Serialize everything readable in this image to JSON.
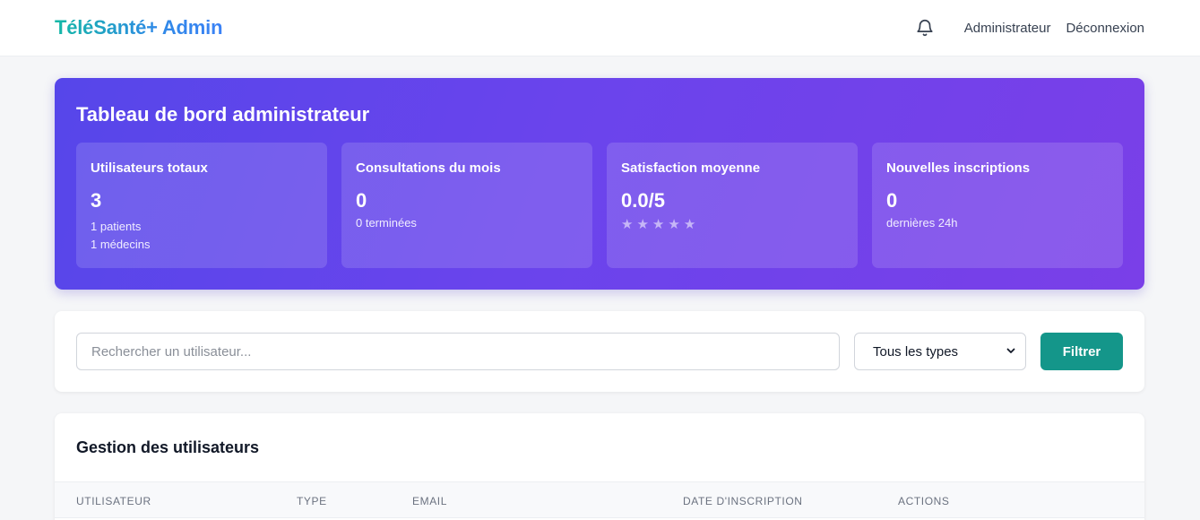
{
  "header": {
    "brand": "TéléSanté+ Admin",
    "user_link": "Administrateur",
    "logout_link": "Déconnexion",
    "bell_icon": "bell-icon"
  },
  "dashboard": {
    "title": "Tableau de bord administrateur",
    "stats": [
      {
        "label": "Utilisateurs totaux",
        "value": "3",
        "sub1": "1 patients",
        "sub2": "1 médecins"
      },
      {
        "label": "Consultations du mois",
        "value": "0",
        "sub1": "0 terminées"
      },
      {
        "label": "Satisfaction moyenne",
        "value": "0.0/5",
        "rating": 0,
        "rating_max": 5
      },
      {
        "label": "Nouvelles inscriptions",
        "value": "0",
        "sub1": "dernières 24h"
      }
    ]
  },
  "filters": {
    "search_placeholder": "Rechercher un utilisateur...",
    "search_value": "",
    "type_selected": "Tous les types",
    "filter_button": "Filtrer"
  },
  "users_table": {
    "title": "Gestion des utilisateurs",
    "columns": [
      "Utilisateur",
      "Type",
      "Email",
      "Date d'inscription",
      "Actions"
    ]
  },
  "colors": {
    "accent_teal": "#14968a",
    "hero_start": "#5646ea",
    "hero_end": "#7a3fe8"
  }
}
